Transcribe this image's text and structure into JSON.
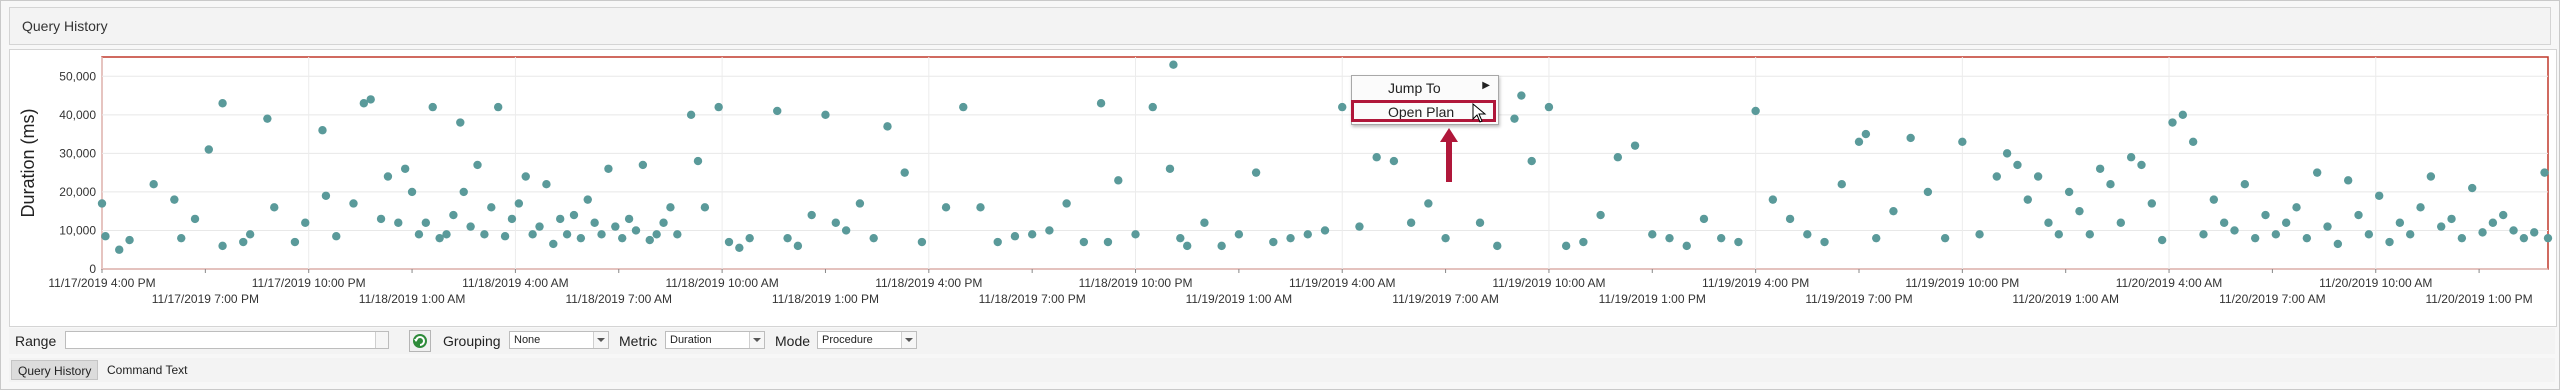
{
  "window": {
    "title": "Query History"
  },
  "chart_data": {
    "type": "scatter",
    "title": "",
    "xlabel": "",
    "ylabel": "Duration (ms)",
    "ylim": [
      0,
      55000
    ],
    "y_ticks": [
      "0",
      "10,000",
      "20,000",
      "30,000",
      "40,000",
      "50,000"
    ],
    "x_ticks_upper": [
      "11/17/2019 4:00 PM",
      "11/17/2019 10:00 PM",
      "11/18/2019 4:00 AM",
      "11/18/2019 10:00 AM",
      "11/18/2019 4:00 PM",
      "11/18/2019 10:00 PM",
      "11/19/2019 4:00 AM",
      "11/19/2019 10:00 AM",
      "11/19/2019 4:00 PM",
      "11/19/2019 10:00 PM",
      "11/20/2019 4:00 AM",
      "11/20/2019 10:00 AM"
    ],
    "x_ticks_lower": [
      "11/17/2019 7:00 PM",
      "11/18/2019 1:00 AM",
      "11/18/2019 7:00 AM",
      "11/18/2019 1:00 PM",
      "11/18/2019 7:00 PM",
      "11/19/2019 1:00 AM",
      "11/19/2019 7:00 AM",
      "11/19/2019 1:00 PM",
      "11/19/2019 7:00 PM",
      "11/20/2019 1:00 AM",
      "11/20/2019 7:00 AM",
      "11/20/2019 1:00 PM"
    ],
    "x_range_hours": [
      0,
      71
    ],
    "grid": true,
    "point_color": "#5a9a9a",
    "plot_border_color": "#c0392b",
    "series": [
      {
        "values": [
          [
            0.0,
            17000
          ],
          [
            0.1,
            8500
          ],
          [
            0.5,
            5000
          ],
          [
            0.8,
            7500
          ],
          [
            1.5,
            22000
          ],
          [
            2.1,
            18000
          ],
          [
            2.3,
            8000
          ],
          [
            2.7,
            13000
          ],
          [
            3.1,
            31000
          ],
          [
            3.5,
            43000
          ],
          [
            3.5,
            6000
          ],
          [
            4.1,
            7000
          ],
          [
            4.3,
            9000
          ],
          [
            4.8,
            39000
          ],
          [
            5.0,
            16000
          ],
          [
            5.6,
            7000
          ],
          [
            5.9,
            12000
          ],
          [
            6.4,
            36000
          ],
          [
            6.5,
            19000
          ],
          [
            6.8,
            8500
          ],
          [
            7.3,
            17000
          ],
          [
            7.6,
            43000
          ],
          [
            7.8,
            44000
          ],
          [
            8.1,
            13000
          ],
          [
            8.3,
            24000
          ],
          [
            8.6,
            12000
          ],
          [
            8.8,
            26000
          ],
          [
            9.0,
            20000
          ],
          [
            9.2,
            9000
          ],
          [
            9.4,
            12000
          ],
          [
            9.6,
            42000
          ],
          [
            9.8,
            8000
          ],
          [
            10.0,
            9000
          ],
          [
            10.2,
            14000
          ],
          [
            10.4,
            38000
          ],
          [
            10.5,
            20000
          ],
          [
            10.7,
            11000
          ],
          [
            10.9,
            27000
          ],
          [
            11.1,
            9000
          ],
          [
            11.3,
            16000
          ],
          [
            11.5,
            42000
          ],
          [
            11.7,
            8500
          ],
          [
            11.9,
            13000
          ],
          [
            12.1,
            17000
          ],
          [
            12.3,
            24000
          ],
          [
            12.5,
            9000
          ],
          [
            12.7,
            11000
          ],
          [
            12.9,
            22000
          ],
          [
            13.1,
            6500
          ],
          [
            13.3,
            13000
          ],
          [
            13.5,
            9000
          ],
          [
            13.7,
            14000
          ],
          [
            13.9,
            8000
          ],
          [
            14.1,
            18000
          ],
          [
            14.3,
            12000
          ],
          [
            14.5,
            9000
          ],
          [
            14.7,
            26000
          ],
          [
            14.9,
            11000
          ],
          [
            15.1,
            8000
          ],
          [
            15.3,
            13000
          ],
          [
            15.5,
            10000
          ],
          [
            15.7,
            27000
          ],
          [
            15.9,
            7500
          ],
          [
            16.1,
            9000
          ],
          [
            16.3,
            12000
          ],
          [
            16.5,
            16000
          ],
          [
            16.7,
            9000
          ],
          [
            17.1,
            40000
          ],
          [
            17.3,
            28000
          ],
          [
            17.5,
            16000
          ],
          [
            17.9,
            42000
          ],
          [
            18.2,
            7000
          ],
          [
            18.5,
            5500
          ],
          [
            18.8,
            8000
          ],
          [
            19.6,
            41000
          ],
          [
            19.9,
            8000
          ],
          [
            20.2,
            6000
          ],
          [
            20.6,
            14000
          ],
          [
            21.0,
            40000
          ],
          [
            21.3,
            12000
          ],
          [
            21.6,
            10000
          ],
          [
            22.0,
            17000
          ],
          [
            22.4,
            8000
          ],
          [
            22.8,
            37000
          ],
          [
            23.3,
            25000
          ],
          [
            23.8,
            7000
          ],
          [
            24.5,
            16000
          ],
          [
            25.0,
            42000
          ],
          [
            25.5,
            16000
          ],
          [
            26.0,
            7000
          ],
          [
            26.5,
            8500
          ],
          [
            27.0,
            9000
          ],
          [
            27.5,
            10000
          ],
          [
            28.0,
            17000
          ],
          [
            28.5,
            7000
          ],
          [
            29.0,
            43000
          ],
          [
            29.2,
            7000
          ],
          [
            29.5,
            23000
          ],
          [
            30.0,
            9000
          ],
          [
            30.5,
            42000
          ],
          [
            31.0,
            26000
          ],
          [
            31.1,
            53000
          ],
          [
            31.3,
            8000
          ],
          [
            31.5,
            6000
          ],
          [
            32.0,
            12000
          ],
          [
            32.5,
            6000
          ],
          [
            33.0,
            9000
          ],
          [
            33.5,
            25000
          ],
          [
            34.0,
            7000
          ],
          [
            34.5,
            8000
          ],
          [
            35.0,
            9000
          ],
          [
            35.5,
            10000
          ],
          [
            36.0,
            42000
          ],
          [
            36.5,
            11000
          ],
          [
            37.0,
            29000
          ],
          [
            37.5,
            28000
          ],
          [
            38.0,
            12000
          ],
          [
            38.5,
            17000
          ],
          [
            39.0,
            8000
          ],
          [
            39.5,
            41000
          ],
          [
            40.0,
            12000
          ],
          [
            40.5,
            6000
          ],
          [
            41.0,
            39000
          ],
          [
            41.2,
            45000
          ],
          [
            41.5,
            28000
          ],
          [
            42.0,
            42000
          ],
          [
            42.5,
            6000
          ],
          [
            43.0,
            7000
          ],
          [
            43.5,
            14000
          ],
          [
            44.0,
            29000
          ],
          [
            44.5,
            32000
          ],
          [
            45.0,
            9000
          ],
          [
            45.5,
            8000
          ],
          [
            46.0,
            6000
          ],
          [
            46.5,
            13000
          ],
          [
            47.0,
            8000
          ],
          [
            47.5,
            7000
          ],
          [
            48.0,
            41000
          ],
          [
            48.5,
            18000
          ],
          [
            49.0,
            13000
          ],
          [
            49.5,
            9000
          ],
          [
            50.0,
            7000
          ],
          [
            50.5,
            22000
          ],
          [
            51.0,
            33000
          ],
          [
            51.2,
            35000
          ],
          [
            51.5,
            8000
          ],
          [
            52.0,
            15000
          ],
          [
            52.5,
            34000
          ],
          [
            53.0,
            20000
          ],
          [
            53.5,
            8000
          ],
          [
            54.0,
            33000
          ],
          [
            54.5,
            9000
          ],
          [
            55.0,
            24000
          ],
          [
            55.3,
            30000
          ],
          [
            55.6,
            27000
          ],
          [
            55.9,
            18000
          ],
          [
            56.2,
            24000
          ],
          [
            56.5,
            12000
          ],
          [
            56.8,
            9000
          ],
          [
            57.1,
            20000
          ],
          [
            57.4,
            15000
          ],
          [
            57.7,
            9000
          ],
          [
            58.0,
            26000
          ],
          [
            58.3,
            22000
          ],
          [
            58.6,
            12000
          ],
          [
            58.9,
            29000
          ],
          [
            59.2,
            27000
          ],
          [
            59.5,
            17000
          ],
          [
            59.8,
            7500
          ],
          [
            60.1,
            38000
          ],
          [
            60.4,
            40000
          ],
          [
            60.7,
            33000
          ],
          [
            61.0,
            9000
          ],
          [
            61.3,
            18000
          ],
          [
            61.6,
            12000
          ],
          [
            61.9,
            10000
          ],
          [
            62.2,
            22000
          ],
          [
            62.5,
            8000
          ],
          [
            62.8,
            14000
          ],
          [
            63.1,
            9000
          ],
          [
            63.4,
            12000
          ],
          [
            63.7,
            16000
          ],
          [
            64.0,
            8000
          ],
          [
            64.3,
            25000
          ],
          [
            64.6,
            11000
          ],
          [
            64.9,
            6500
          ],
          [
            65.2,
            23000
          ],
          [
            65.5,
            14000
          ],
          [
            65.8,
            9000
          ],
          [
            66.1,
            19000
          ],
          [
            66.4,
            7000
          ],
          [
            66.7,
            12000
          ],
          [
            67.0,
            9000
          ],
          [
            67.3,
            16000
          ],
          [
            67.6,
            24000
          ],
          [
            67.9,
            11000
          ],
          [
            68.2,
            13000
          ],
          [
            68.5,
            8000
          ],
          [
            68.8,
            21000
          ],
          [
            69.1,
            9500
          ],
          [
            69.4,
            12000
          ],
          [
            69.7,
            14000
          ],
          [
            70.0,
            10000
          ],
          [
            70.3,
            8000
          ],
          [
            70.6,
            9500
          ],
          [
            70.9,
            25000
          ],
          [
            71.0,
            8000
          ]
        ]
      }
    ]
  },
  "context_menu": {
    "items": [
      {
        "label": "Jump To",
        "has_submenu": true
      },
      {
        "label": "Open Plan",
        "highlighted": true
      }
    ]
  },
  "controls": {
    "range_label": "Range",
    "range_value": "",
    "grouping_label": "Grouping",
    "grouping_value": "None",
    "metric_label": "Metric",
    "metric_value": "Duration",
    "mode_label": "Mode",
    "mode_value": "Procedure"
  },
  "tabs": [
    {
      "label": "Query History",
      "active": true
    },
    {
      "label": "Command Text",
      "active": false
    }
  ],
  "icons": {
    "refresh": "refresh-icon",
    "cursor": "mouse-pointer-icon",
    "annotation_arrow": "red-up-arrow-icon"
  }
}
